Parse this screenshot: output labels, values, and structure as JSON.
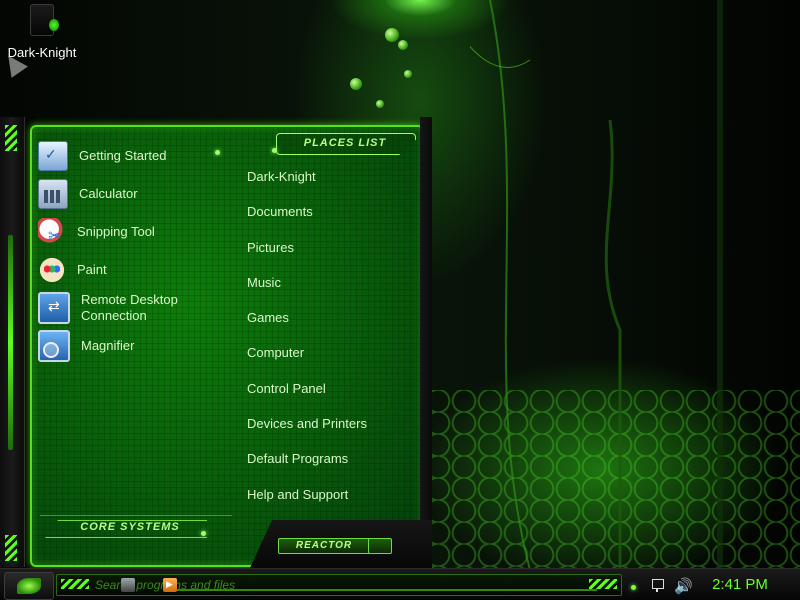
{
  "desktop": {
    "icon_label": "Dark-Knight"
  },
  "start_menu": {
    "programs": [
      {
        "label": "Getting Started",
        "icon": "getting-started-icon"
      },
      {
        "label": "Calculator",
        "icon": "calculator-icon"
      },
      {
        "label": "Snipping Tool",
        "icon": "snipping-tool-icon"
      },
      {
        "label": "Paint",
        "icon": "paint-icon"
      },
      {
        "label": "Remote Desktop Connection",
        "icon": "remote-desktop-icon"
      },
      {
        "label": "Magnifier",
        "icon": "magnifier-icon"
      }
    ],
    "places_title": "PLACES LIST",
    "places": [
      "Dark-Knight",
      "Documents",
      "Pictures",
      "Music",
      "Games",
      "Computer",
      "Control Panel",
      "Devices and Printers",
      "Default Programs",
      "Help and Support"
    ],
    "core_systems_label": "CORE SYSTEMS",
    "reactor_label": "REACTOR"
  },
  "taskbar": {
    "search_placeholder": "Search programs and files",
    "clock": "2:41 PM"
  },
  "theme": {
    "accent": "#55e41c",
    "text": "#d8f8c8",
    "clock": "#6aff2a"
  }
}
